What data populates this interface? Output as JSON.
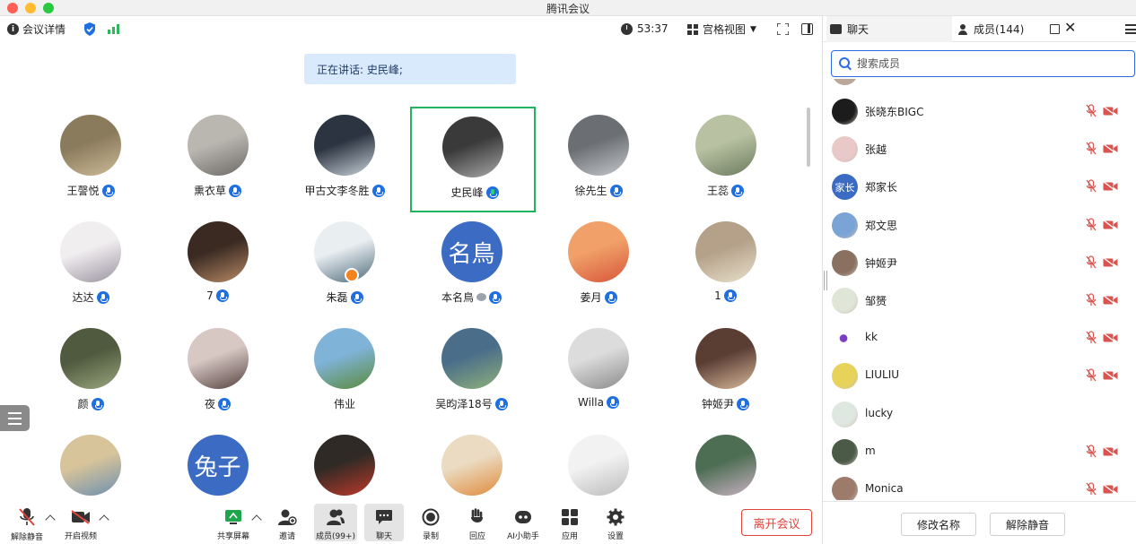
{
  "window": {
    "title": "腾讯会议"
  },
  "topbar": {
    "info_label": "会议详情",
    "timer": "53:37",
    "view_label": "宫格视图"
  },
  "banner": {
    "text": "正在讲话: 史民峰;"
  },
  "participants": [
    {
      "name": "王謦悦",
      "mic": "on",
      "avatar": "photo"
    },
    {
      "name": "熏衣草",
      "mic": "on",
      "avatar": "photo"
    },
    {
      "name": "甲古文李冬胜",
      "mic": "on",
      "avatar": "photo"
    },
    {
      "name": "史民峰",
      "mic": "speaking",
      "avatar": "photo",
      "active": true
    },
    {
      "name": "徐先生",
      "mic": "on",
      "avatar": "photo"
    },
    {
      "name": "王蕊",
      "mic": "on",
      "avatar": "photo"
    },
    {
      "name": "达达",
      "mic": "on",
      "avatar": "photo"
    },
    {
      "name": "7",
      "mic": "on",
      "avatar": "photo"
    },
    {
      "name": "朱磊",
      "mic": "on",
      "avatar": "photo",
      "host": true
    },
    {
      "name": "本名鳥",
      "mic": "on",
      "avatar_text": "名鳥",
      "extra_icon": true
    },
    {
      "name": "姜月",
      "mic": "on",
      "avatar": "photo"
    },
    {
      "name": "1",
      "mic": "on",
      "avatar": "photo"
    },
    {
      "name": "颜",
      "mic": "on",
      "avatar": "photo"
    },
    {
      "name": "夜",
      "mic": "on",
      "avatar": "photo"
    },
    {
      "name": "伟业",
      "mic": "none",
      "avatar": "photo"
    },
    {
      "name": "吴昀泽18号",
      "mic": "on",
      "avatar": "photo"
    },
    {
      "name": "Willa",
      "mic": "on",
      "avatar": "photo"
    },
    {
      "name": "钟姬尹",
      "mic": "on",
      "avatar": "photo"
    },
    {
      "name": "",
      "mic": "none",
      "avatar": "photo"
    },
    {
      "name": "",
      "mic": "none",
      "avatar_text": "兔子"
    },
    {
      "name": "",
      "mic": "none",
      "avatar": "photo"
    },
    {
      "name": "",
      "mic": "none",
      "avatar": "photo"
    },
    {
      "name": "",
      "mic": "none",
      "avatar": "photo"
    },
    {
      "name": "",
      "mic": "none",
      "avatar": "photo"
    }
  ],
  "toolbar": {
    "unmute": "解除静音",
    "start_video": "开启视频",
    "share_screen": "共享屏幕",
    "invite": "邀请",
    "members": "成员(99+)",
    "chat": "聊天",
    "record": "录制",
    "react": "回应",
    "ai_assistant": "AI小助手",
    "apps": "应用",
    "settings": "设置",
    "leave": "离开会议"
  },
  "panel": {
    "chat_tab": "聊天",
    "members_tab": "成员(144)",
    "search_placeholder": "搜索成员",
    "members": [
      {
        "name": "张晓东BIGC",
        "muted": true,
        "cam_off": true
      },
      {
        "name": "张越",
        "muted": true,
        "cam_off": true
      },
      {
        "name": "郑家长",
        "muted": true,
        "cam_off": true,
        "avatar_text": "家长"
      },
      {
        "name": "郑文思",
        "muted": true,
        "cam_off": true
      },
      {
        "name": "钟姬尹",
        "muted": true,
        "cam_off": true
      },
      {
        "name": "邹赟",
        "muted": true,
        "cam_off": true
      },
      {
        "name": "kk",
        "muted": true,
        "cam_off": true
      },
      {
        "name": "LIULIU",
        "muted": true,
        "cam_off": true
      },
      {
        "name": "lucky",
        "muted": false,
        "cam_off": false
      },
      {
        "name": "m",
        "muted": true,
        "cam_off": true
      },
      {
        "name": "Monica",
        "muted": true,
        "cam_off": true
      }
    ],
    "rename_button": "修改名称",
    "unmute_button": "解除静音"
  }
}
